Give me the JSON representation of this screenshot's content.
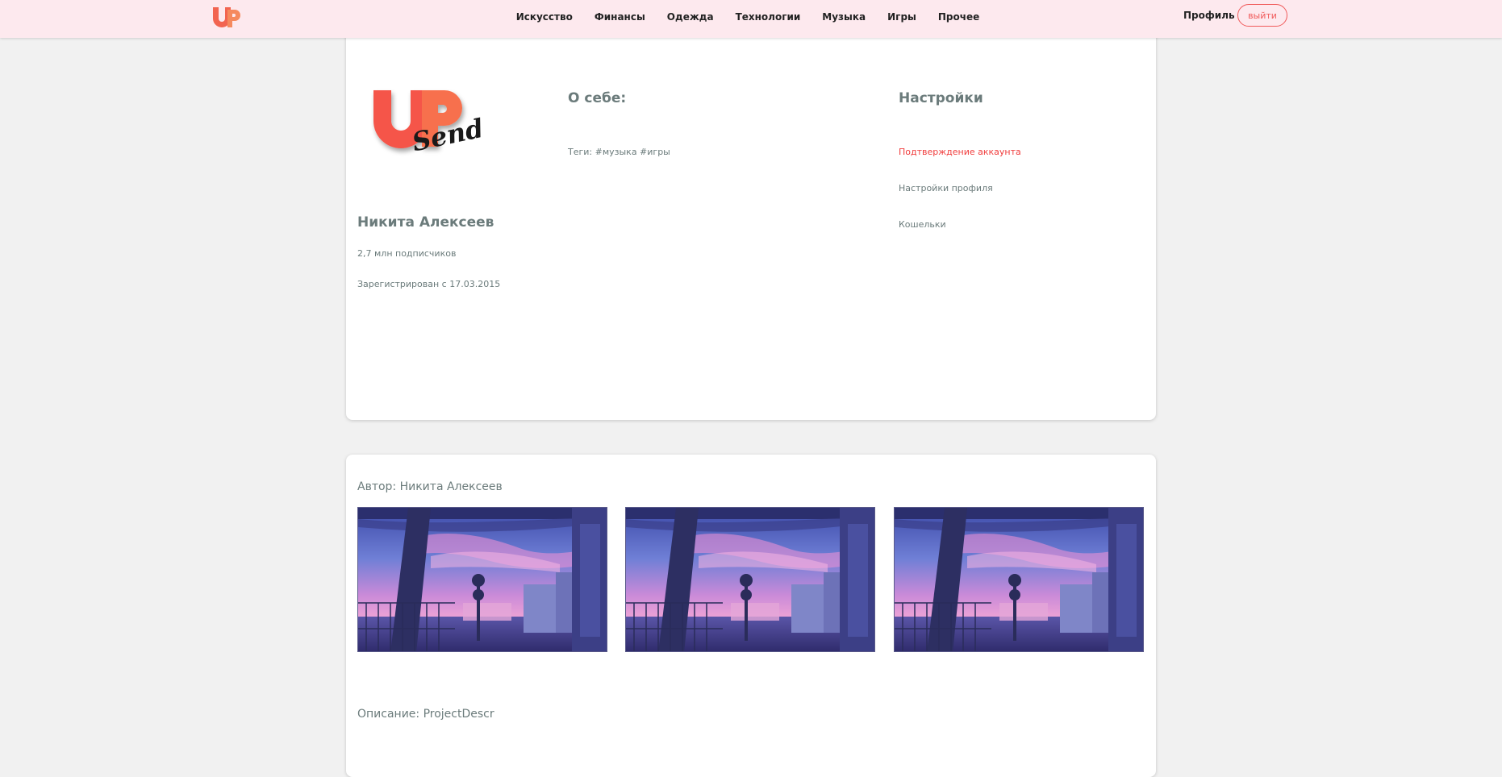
{
  "header": {
    "logo_text": "UP",
    "nav": [
      "Искусство",
      "Финансы",
      "Одежда",
      "Технологии",
      "Музыка",
      "Игры",
      "Прочее"
    ],
    "profile_label": "Профиль",
    "logout_label": "выйти"
  },
  "profile": {
    "logo_main": "UP",
    "logo_script": "Send",
    "name": "Никита Алексеев",
    "subscribers": "2,7 млн подписчиков",
    "registered": "Зарегистрирован с 17.03.2015",
    "about_title": "О себе:",
    "tags": "Теги: #музыка #игры"
  },
  "settings": {
    "title": "Настройки",
    "verify": "Подтверждение аккаунта",
    "profile_settings": "Настройки профиля",
    "wallets": "Кошельки"
  },
  "project": {
    "author": "Автор: Никита Алексеев",
    "description": "Описание: ProjectDescr",
    "images": [
      "anime-sunset-image",
      "anime-sunset-image",
      "anime-sunset-image"
    ]
  },
  "colors": {
    "header_bg": "#fde9ee",
    "accent": "#f05a5a",
    "logo": "#f26450",
    "page_bg": "#f1f1f1"
  }
}
